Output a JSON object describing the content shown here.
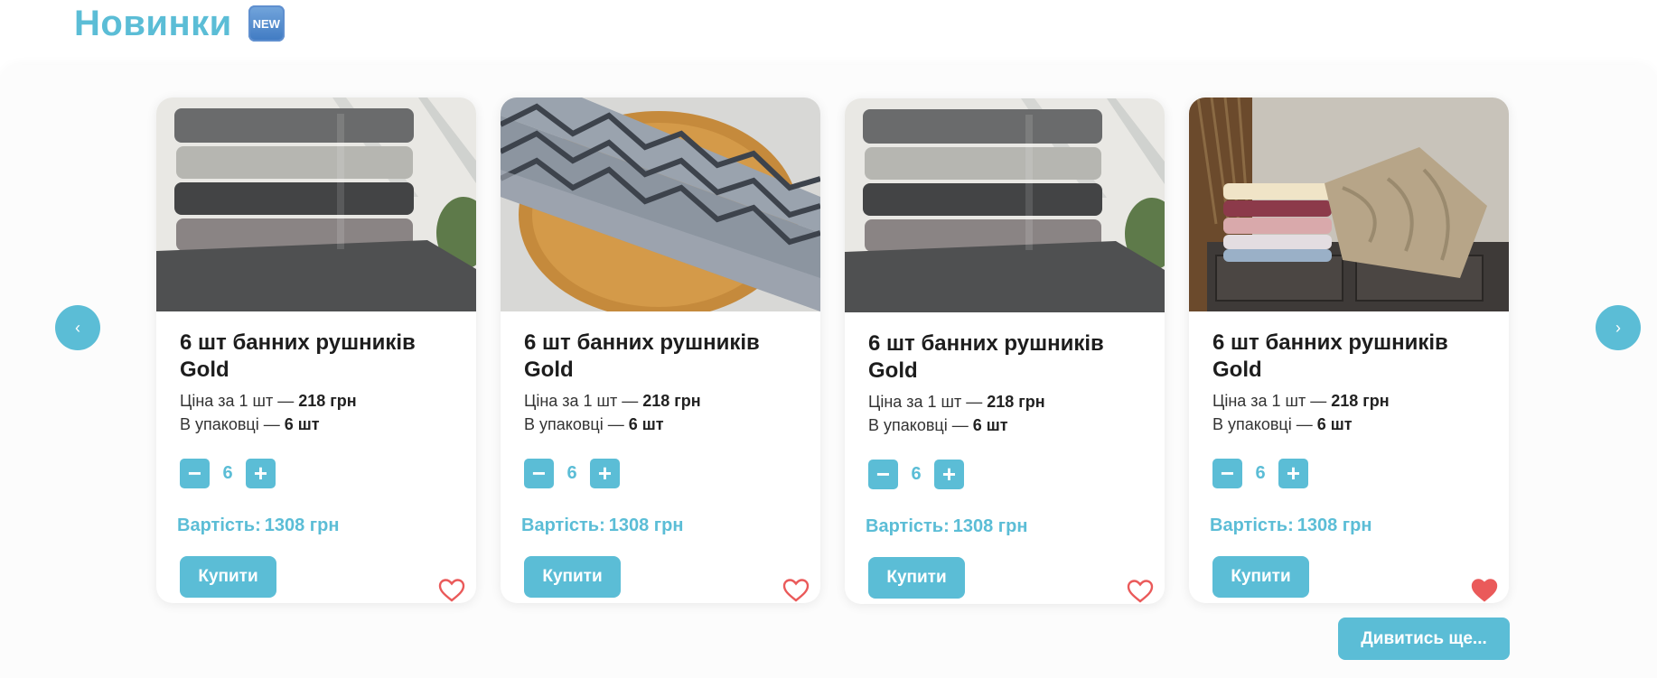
{
  "section": {
    "title": "Новинки",
    "badge": "NEW"
  },
  "carousel": {
    "prev_icon": "‹",
    "next_icon": "›"
  },
  "colors": {
    "accent": "#5bbdd6",
    "heart": "#ea5a5a"
  },
  "products": [
    {
      "title": "6 шт банних рушників Gold",
      "price_label": "Ціна за 1 шт — ",
      "price_value": "218 грн",
      "pack_label": "В упаковці — ",
      "pack_value": "6 шт",
      "minus": "−",
      "quantity": "6",
      "plus": "+",
      "total_label": "Вартість:",
      "total_value": "1308 грн",
      "buy_label": "Купити",
      "favorited": false
    },
    {
      "title": "6 шт банних рушників Gold",
      "price_label": "Ціна за 1 шт — ",
      "price_value": "218 грн",
      "pack_label": "В упаковці — ",
      "pack_value": "6 шт",
      "minus": "−",
      "quantity": "6",
      "plus": "+",
      "total_label": "Вартість:",
      "total_value": "1308 грн",
      "buy_label": "Купити",
      "favorited": false
    },
    {
      "title": "6 шт банних рушників Gold",
      "price_label": "Ціна за 1 шт — ",
      "price_value": "218 грн",
      "pack_label": "В упаковці — ",
      "pack_value": "6 шт",
      "minus": "−",
      "quantity": "6",
      "plus": "+",
      "total_label": "Вартість:",
      "total_value": "1308 грн",
      "buy_label": "Купити",
      "favorited": false
    },
    {
      "title": "6 шт банних рушників Gold",
      "price_label": "Ціна за 1 шт — ",
      "price_value": "218 грн",
      "pack_label": "В упаковці — ",
      "pack_value": "6 шт",
      "minus": "−",
      "quantity": "6",
      "plus": "+",
      "total_label": "Вартість:",
      "total_value": "1308 грн",
      "buy_label": "Купити",
      "favorited": true
    }
  ],
  "more_button": {
    "label": "Дивитись ще..."
  }
}
